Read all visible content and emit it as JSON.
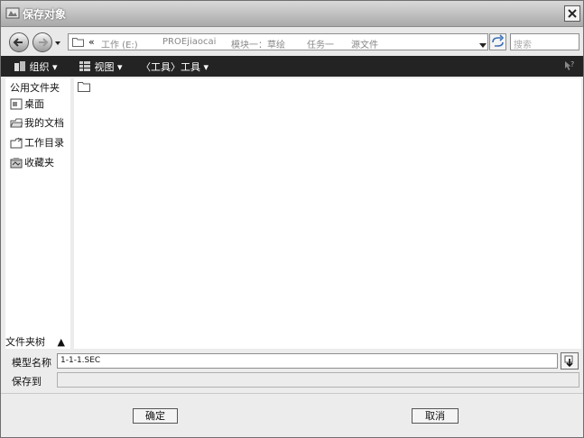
{
  "window": {
    "title": "保存对象"
  },
  "address": {
    "crumbs": [
      "工作 (E:)",
      "PROEjiaocai",
      "模块一：草绘",
      "任务一",
      "源文件"
    ],
    "search_placeholder": "搜索"
  },
  "toolbar": {
    "organize": "组织",
    "view": "视图",
    "tools": "〈工具〉工具"
  },
  "leftpane": {
    "header": "公用文件夹",
    "items": [
      {
        "label": "桌面",
        "icon": "desktop-icon"
      },
      {
        "label": "我的文档",
        "icon": "documents-icon"
      },
      {
        "label": "工作目录",
        "icon": "working-directory-icon"
      },
      {
        "label": "收藏夹",
        "icon": "favorites-icon"
      }
    ],
    "tree_toggle": "文件夹树"
  },
  "form": {
    "model_name_label": "模型名称",
    "model_name_value": "1-1-1.SEC",
    "save_to_label": "保存到",
    "save_to_value": ""
  },
  "buttons": {
    "ok": "确定",
    "cancel": "取消"
  }
}
